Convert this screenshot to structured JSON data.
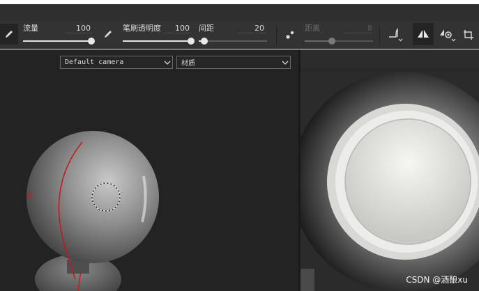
{
  "toolbar": {
    "flow": {
      "label": "流量",
      "value": "100",
      "level": 1.0
    },
    "brush_opacity": {
      "label": "笔刷透明度",
      "value": "100",
      "level": 1.0
    },
    "spacing": {
      "label": "间距",
      "value": "20",
      "level": 0.08
    },
    "distance": {
      "label": "距离",
      "value": "8",
      "level": 0.4
    },
    "icons": [
      "brush-icon",
      "brush-small-icon",
      "dots-icon",
      "curve-icon",
      "mirror-icon",
      "symmetry-settings-icon",
      "transform-icon"
    ]
  },
  "viewport": {
    "camera_select": {
      "value": "Default camera"
    },
    "material_select": {
      "value": "材质"
    }
  },
  "watermark": {
    "text": "CSDN @酒酿xu"
  }
}
